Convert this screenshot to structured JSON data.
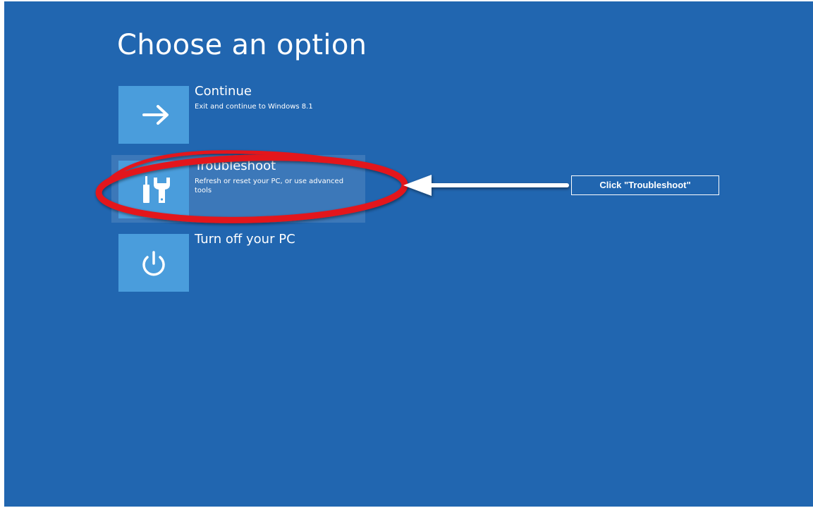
{
  "page": {
    "title": "Choose an option"
  },
  "options": [
    {
      "label": "Continue",
      "description": "Exit and continue to Windows 8.1",
      "icon": "arrow-right-icon"
    },
    {
      "label": "Troubleshoot",
      "description": "Refresh or reset your PC, or use advanced tools",
      "icon": "tools-icon"
    },
    {
      "label": "Turn off your PC",
      "description": "",
      "icon": "power-icon"
    }
  ],
  "annotation": {
    "callout_text": "Click \"Troubleshoot\"",
    "highlight_color": "#e3161b",
    "arrow_color": "#ffffff"
  },
  "colors": {
    "background": "#2166b0",
    "tile": "#4a9ddc",
    "text": "#ffffff"
  }
}
